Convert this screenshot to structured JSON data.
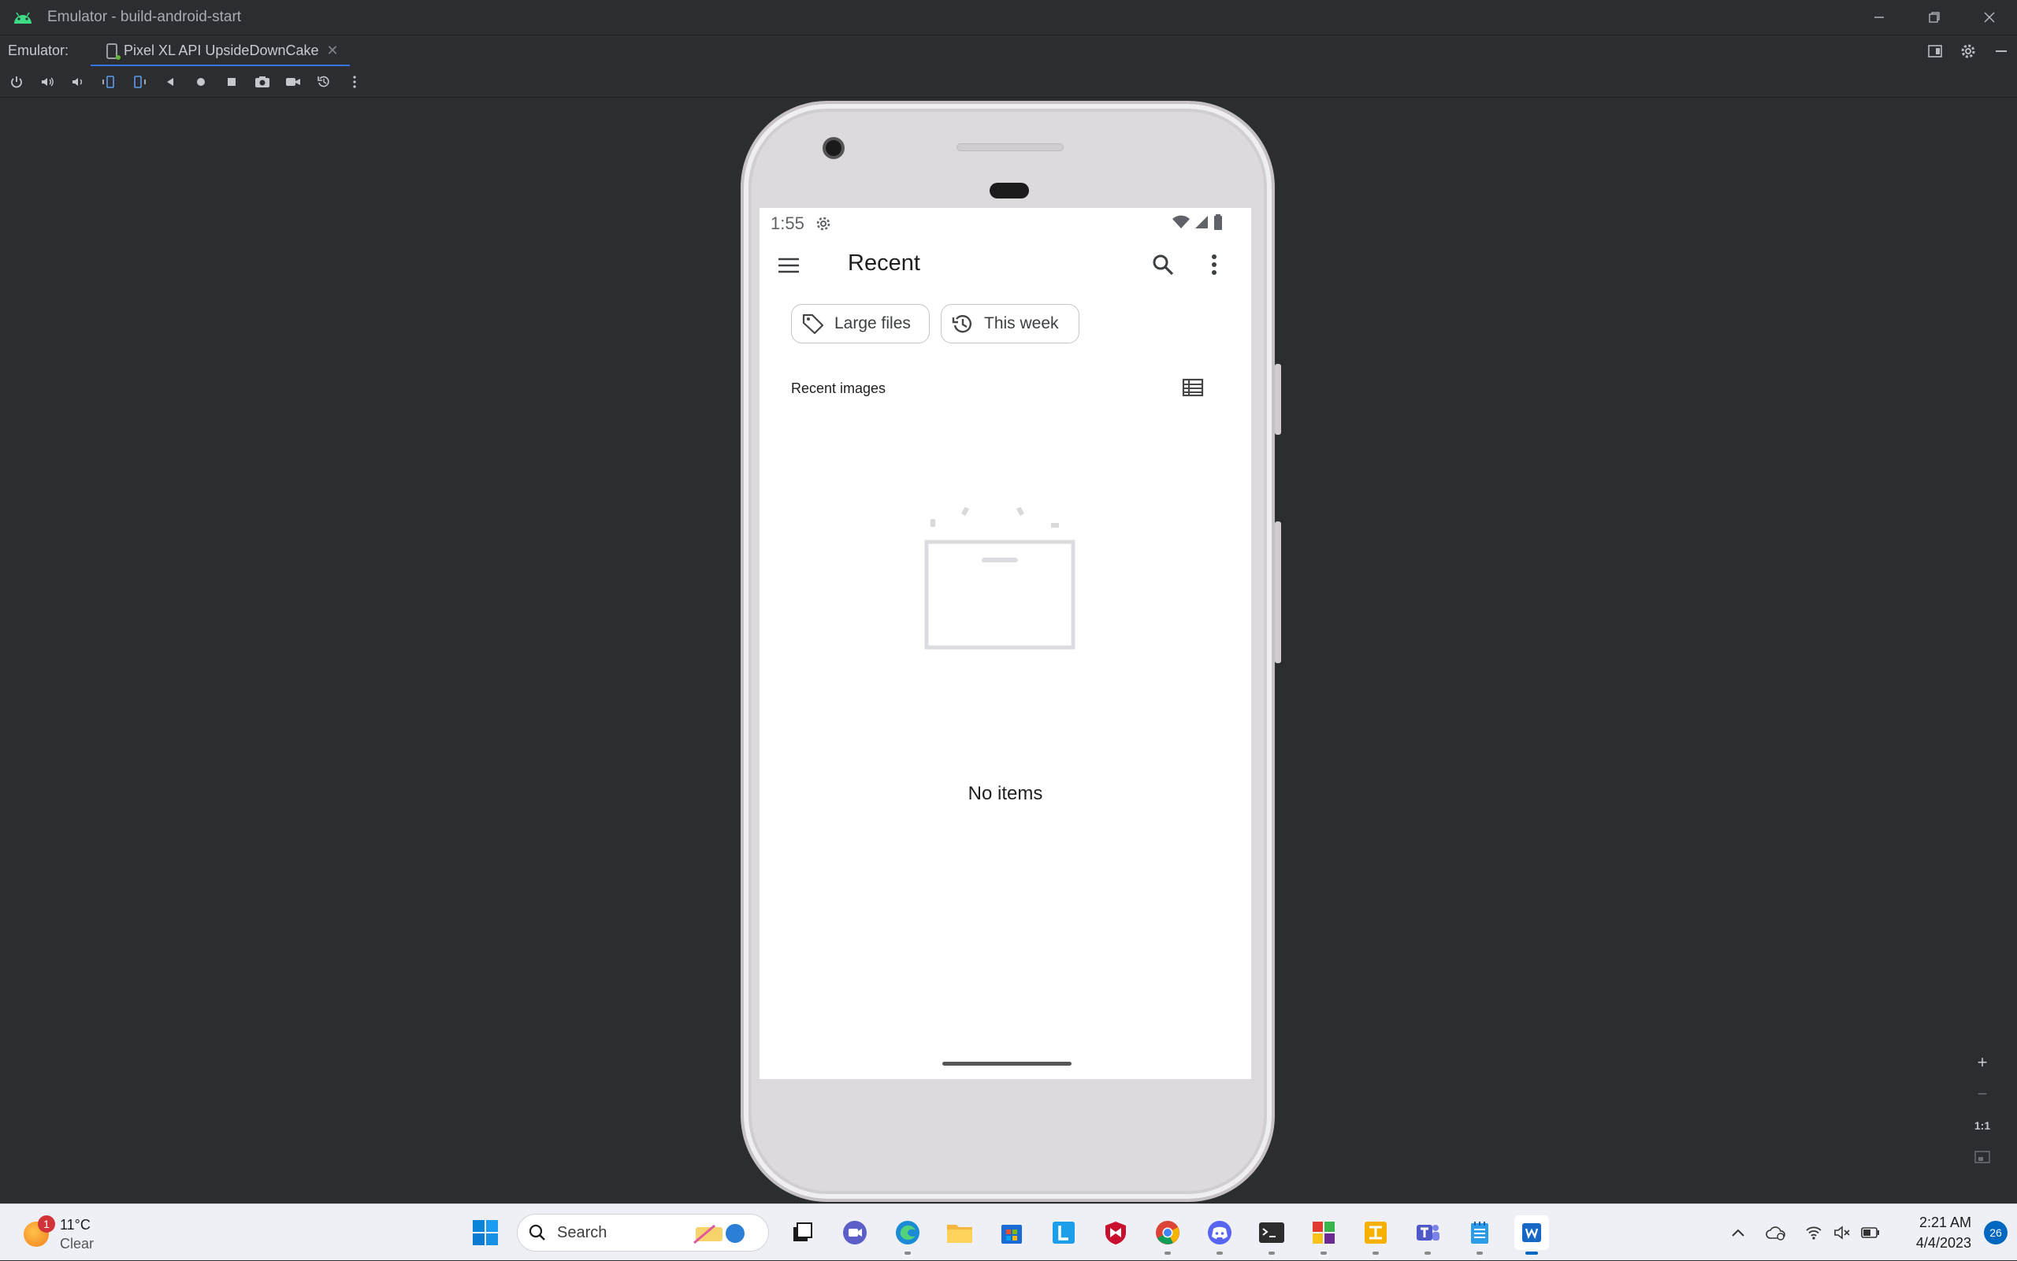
{
  "window": {
    "title": "Emulator - build-android-start"
  },
  "tabbar": {
    "label": "Emulator:",
    "tab_name": "Pixel XL API UpsideDownCake"
  },
  "toolbar": {
    "buttons": [
      "power-icon",
      "volume-up-icon",
      "volume-down-icon",
      "rotate-left-icon",
      "rotate-right-icon",
      "back-icon",
      "home-icon",
      "overview-icon",
      "camera-icon",
      "record-icon",
      "reset-icon",
      "more-icon"
    ]
  },
  "zoom": {
    "zoom_in": "+",
    "zoom_out": "−",
    "one_to_one": "1:1"
  },
  "phone": {
    "status": {
      "time": "1:55"
    },
    "appbar": {
      "title": "Recent"
    },
    "chips": [
      {
        "label": "Large files"
      },
      {
        "label": "This week"
      }
    ],
    "section_title": "Recent images",
    "empty_message": "No items",
    "accent_color": "#ea4335"
  },
  "taskbar": {
    "weather": {
      "badge": "1",
      "temp": "11°C",
      "condition": "Clear"
    },
    "search_placeholder": "Search",
    "clock": {
      "time": "2:21 AM",
      "date": "4/4/2023"
    },
    "notifications": "26"
  }
}
